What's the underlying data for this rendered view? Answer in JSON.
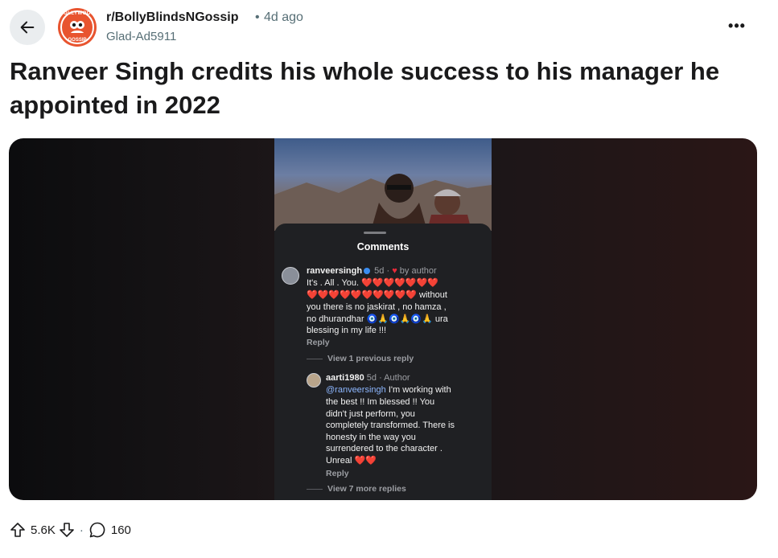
{
  "header": {
    "subreddit": "r/BollyBlindsNGossip",
    "time_ago": "4d ago",
    "author": "Glad-Ad5911",
    "avatar_text_top": "BOLLYWOOD",
    "avatar_text_bottom": "GOSSIP",
    "overflow_label": "•••"
  },
  "post": {
    "title": "Ranveer Singh credits his whole success to his manager he appointed in 2022"
  },
  "media": {
    "comments_title": "Comments",
    "comment1": {
      "user": "ranveersingh",
      "meta": "5d ·",
      "meta_author": "by author",
      "line1": "It's . All . You. ❤️❤️❤️❤️❤️❤️❤️",
      "line2": "❤️❤️❤️❤️❤️❤️❤️❤️❤️❤️ without",
      "line3": "you there is no jaskirat , no hamza ,",
      "line4": "no dhurandhar 🧿🙏🧿🙏🧿🙏 ura",
      "line5": "blessing in my life !!!",
      "reply": "Reply"
    },
    "view_previous": "View 1 previous reply",
    "comment2": {
      "user": "aarti1980",
      "meta": "5d · Author",
      "mention": "@ranveersingh",
      "line1_rest": " I'm working with",
      "line2": "the best !! Im blessed !! You",
      "line3": "didn't  just perform, you",
      "line4": "completely transformed. There is",
      "line5": "honesty in the way you",
      "line6": "surrendered to the character .",
      "line7": "Unreal ❤️❤️",
      "reply": "Reply"
    },
    "view_more": "View 7 more replies"
  },
  "footer": {
    "upvotes": "5.6K",
    "separator": "·",
    "comments": "160"
  },
  "colors": {
    "accent_orange": "#e8542f",
    "muted_text": "#576f76",
    "heart_red": "#ea2b3a"
  }
}
